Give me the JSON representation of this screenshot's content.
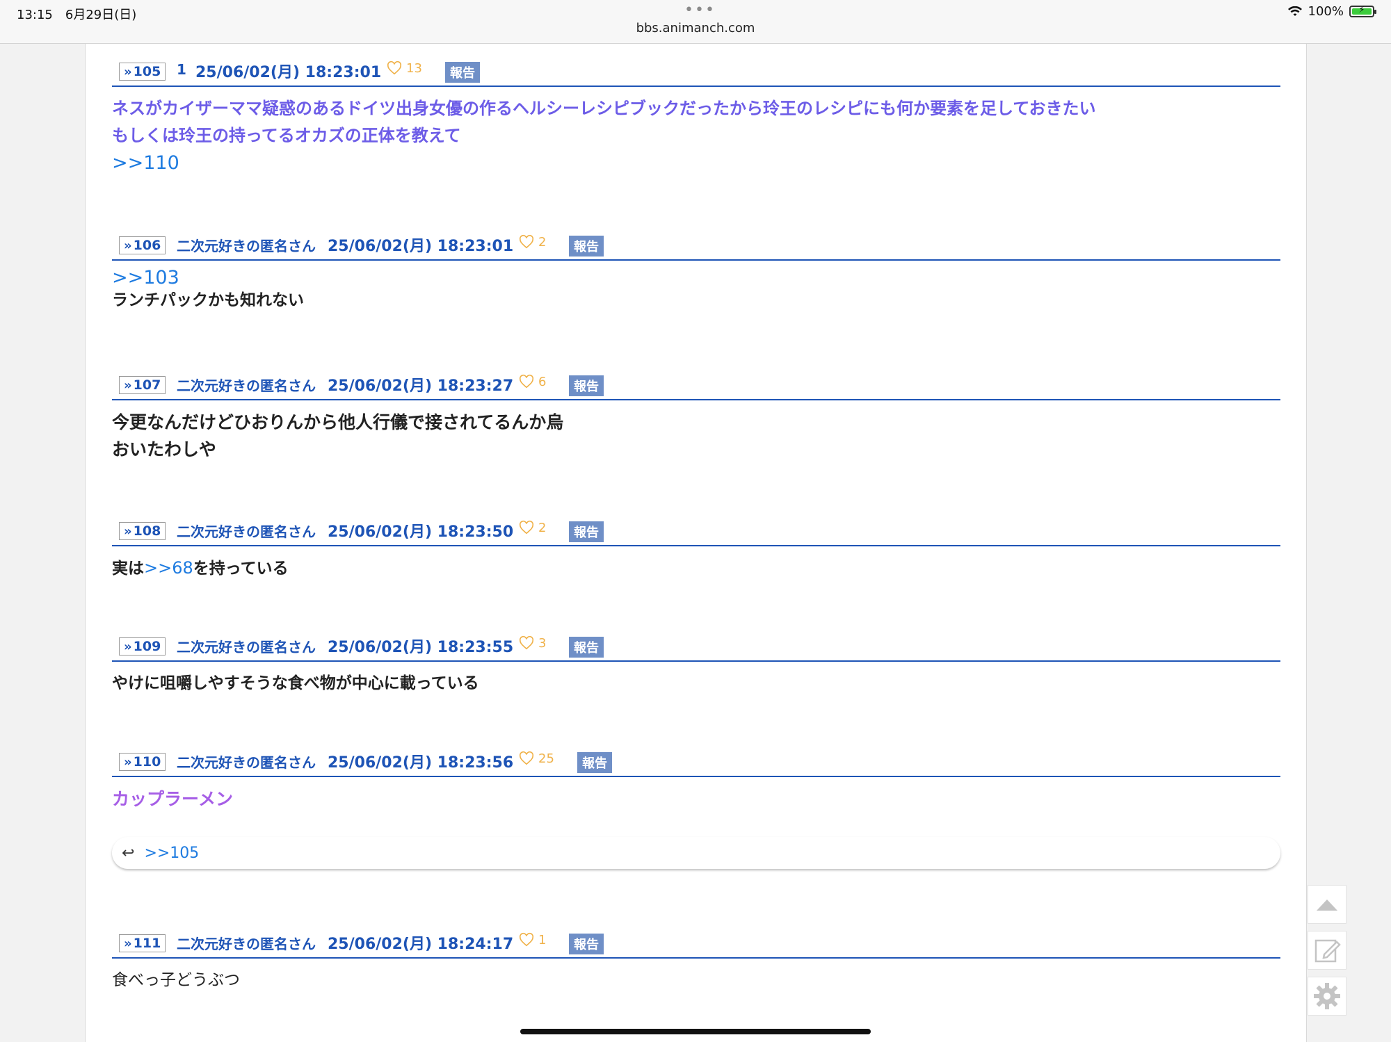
{
  "status_bar": {
    "time_date": "13:15　6月29日(日)",
    "url": "bbs.animanch.com",
    "battery": "100%"
  },
  "posts": [
    {
      "num": "105",
      "name": "1",
      "date": "25/06/02(月) 18:23:01",
      "likes": "13",
      "report": "報告",
      "body_lines": [
        "ネスがカイザーママ疑惑のあるドイツ出身女優の作るヘルシーレシピブックだったから玲王のレシピにも何か要素を足しておきたい",
        "もしくは玲王の持ってるオカズの正体を教えて"
      ],
      "anchor": ">>110"
    },
    {
      "num": "106",
      "name": "二次元好きの匿名さん",
      "date": "25/06/02(月) 18:23:01",
      "likes": "2",
      "report": "報告",
      "anchor": ">>103",
      "body_lines": [
        "ランチパックかも知れない"
      ]
    },
    {
      "num": "107",
      "name": "二次元好きの匿名さん",
      "date": "25/06/02(月) 18:23:27",
      "likes": "6",
      "report": "報告",
      "body_lines": [
        "今更なんだけどひおりんから他人行儀で接されてるんか烏",
        "おいたわしや"
      ]
    },
    {
      "num": "108",
      "name": "二次元好きの匿名さん",
      "date": "25/06/02(月) 18:23:50",
      "likes": "2",
      "report": "報告",
      "body_pre": "実は",
      "body_anchor": ">>68",
      "body_post": "を持っている"
    },
    {
      "num": "109",
      "name": "二次元好きの匿名さん",
      "date": "25/06/02(月) 18:23:55",
      "likes": "3",
      "report": "報告",
      "body_lines": [
        "やけに咀嚼しやすそうな食べ物が中心に載っている"
      ]
    },
    {
      "num": "110",
      "name": "二次元好きの匿名さん",
      "date": "25/06/02(月) 18:23:56",
      "likes": "25",
      "report": "報告",
      "body_lines": [
        "カップラーメン"
      ],
      "reply_ref": ">>105"
    },
    {
      "num": "111",
      "name": "二次元好きの匿名さん",
      "date": "25/06/02(月) 18:24:17",
      "likes": "1",
      "report": "報告",
      "body_lines": [
        "食べっ子どうぶつ"
      ]
    }
  ],
  "side_buttons": [
    "arrow-up-icon",
    "edit-icon",
    "gear-icon"
  ]
}
